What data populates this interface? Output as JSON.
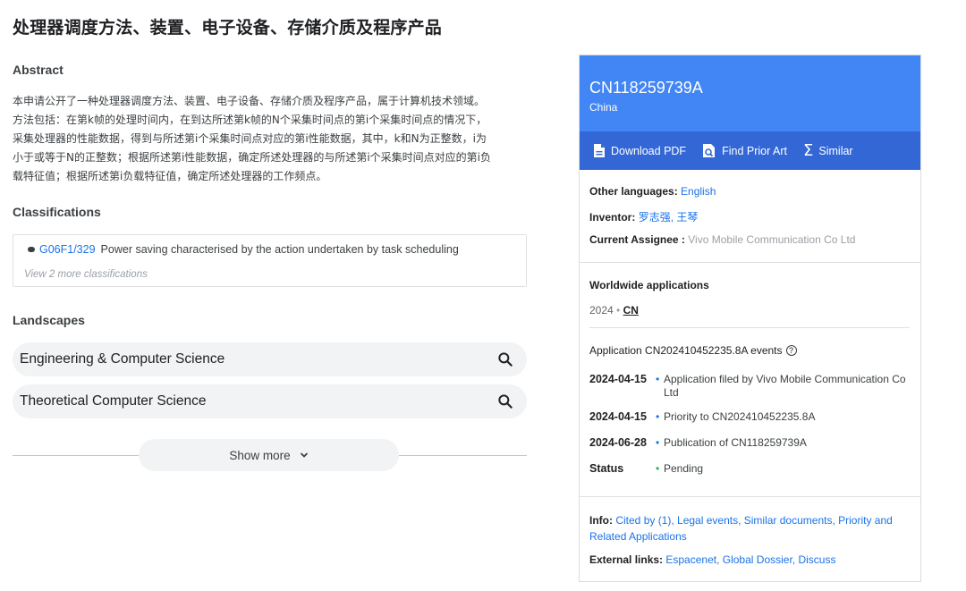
{
  "title": "处理器调度方法、装置、电子设备、存储介质及程序产品",
  "abstract": {
    "heading": "Abstract",
    "lines": [
      "本申请公开了一种处理器调度方法、装置、电子设备、存储介质及程序产品，属于计算机技术领域。",
      "方法包括：在第k帧的处理时间内，在到达所述第k帧的N个采集时间点的第i个采集时间点的情况下，",
      "采集处理器的性能数据，得到与所述第i个采集时间点对应的第i性能数据，其中，k和N为正整数，i为",
      "小于或等于N的正整数；根据所述第i性能数据，确定所述处理器的与所述第i个采集时间点对应的第i负",
      "载特征值；根据所述第i负载特征值，确定所述处理器的工作频点。"
    ]
  },
  "classifications": {
    "heading": "Classifications",
    "code": "G06F1/329",
    "description": "Power saving characterised by the action undertaken by task scheduling",
    "view_more": "View 2 more classifications"
  },
  "landscapes": {
    "heading": "Landscapes",
    "items": [
      "Engineering & Computer Science",
      "Theoretical Computer Science"
    ],
    "icon": "search-icon"
  },
  "show_more": "Show more",
  "card": {
    "pub_number": "CN118259739A",
    "country": "China",
    "actions": {
      "download": "Download PDF",
      "prior_art": "Find Prior Art",
      "similar": "Similar"
    },
    "other_languages_label": "Other languages:",
    "other_languages_value": "English",
    "inventor_label": "Inventor:",
    "inventor_value": "罗志强, 王琴",
    "assignee_label": "Current Assignee :",
    "assignee_value": "Vivo Mobile Communication Co Ltd",
    "worldwide_heading": "Worldwide applications",
    "worldwide_year": "2024",
    "worldwide_sep": "•",
    "worldwide_country": "CN",
    "events_heading": "Application CN202410452235.8A events",
    "events": [
      {
        "date": "2024-04-15",
        "text": "Application filed by Vivo Mobile Communication Co Ltd"
      },
      {
        "date": "2024-04-15",
        "text": "Priority to CN202410452235.8A"
      },
      {
        "date": "2024-06-28",
        "text": "Publication of CN118259739A"
      }
    ],
    "status_label": "Status",
    "status_value": "Pending",
    "info_label": "Info:",
    "info_links": "Cited by (1), Legal events, Similar documents, Priority and Related Applications",
    "external_label": "External links:",
    "external_links": "Espacenet, Global Dossier, Discuss",
    "colors": {
      "header": "#4285f4",
      "actions": "#3367d6",
      "link": "#1a73e8",
      "status_dot": "#34a853"
    }
  }
}
